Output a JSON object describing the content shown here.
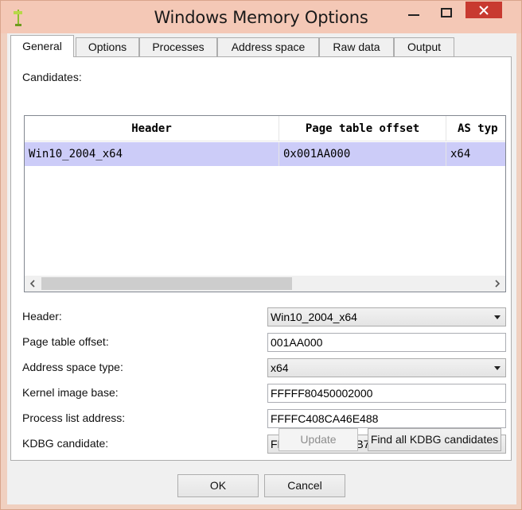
{
  "window": {
    "title": "Windows Memory Options",
    "app_icon": "hammer-icon",
    "controls": [
      "minimize-icon",
      "maximize-icon",
      "close-icon"
    ],
    "close_color": "#c83a30"
  },
  "tabs": [
    {
      "label": "General",
      "active": true
    },
    {
      "label": "Options"
    },
    {
      "label": "Processes"
    },
    {
      "label": "Address space"
    },
    {
      "label": "Raw data"
    },
    {
      "label": "Output"
    }
  ],
  "candidates": {
    "label": "Candidates:",
    "columns": [
      "Header",
      "Page table offset",
      "AS typ"
    ],
    "rows": [
      {
        "header": "Win10_2004_x64",
        "page_table_offset": "0x001AA000",
        "as_type": "x64",
        "selected": true
      }
    ],
    "selection_color": "#ccccf8"
  },
  "form": {
    "header": {
      "label": "Header:",
      "value": "Win10_2004_x64"
    },
    "page_table_offset": {
      "label": "Page table offset:",
      "value": "001AA000"
    },
    "address_space_type": {
      "label": "Address space type:",
      "value": "x64"
    },
    "kernel_image_base": {
      "label": "Kernel image base:",
      "value": "FFFFF80450002000"
    },
    "process_list_address": {
      "label": "Process list address:",
      "value": "FFFFC408CA46E488"
    },
    "kdbg_candidate": {
      "label": "KDBG candidate:",
      "value": "FFFFF80450C02B70 (0x380 bytes)"
    }
  },
  "buttons": {
    "update": "Update",
    "find_kdbg": "Find all KDBG candidates",
    "ok": "OK",
    "cancel": "Cancel"
  }
}
